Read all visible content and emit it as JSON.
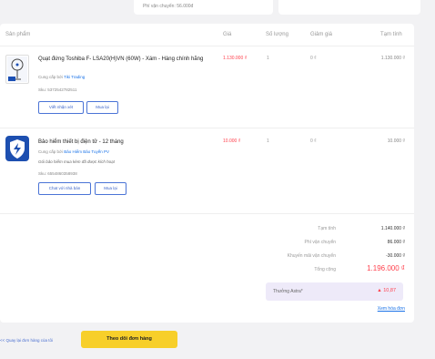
{
  "shipping_note": "Phí vận chuyển: 56.000đ",
  "columns": {
    "product": "Sản phẩm",
    "price": "Giá",
    "qty": "Số lượng",
    "discount": "Giảm giá",
    "subtotal": "Tạm tính"
  },
  "items": [
    {
      "name": "Quạt đứng Toshiba F- LSA20(H)VN (60W) - Xám - Hàng chính hãng",
      "supplier_prefix": "Cung cấp bởi",
      "supplier": "Tiki Trading",
      "sku": "Sku: 5372542782511",
      "btn1": "Viết nhận xét",
      "btn2": "Mua lại",
      "price": "1.130.000 ₫",
      "qty": "1",
      "discount": "0 ₫",
      "subtotal": "1.130.000 ₫"
    },
    {
      "name": "Bảo hiểm thiết bị điện tử - 12 tháng",
      "supplier_prefix": "Cung cấp bởi",
      "supplier": "Bảo Hiểm Bảo Tuyến PV",
      "note": "Gói bảo hiểm mua kèm đã được kích hoạt",
      "sku": "Sku: 6554860358938",
      "btn1": "Chat với nhà bán",
      "btn2": "Mua lại",
      "price": "10.000 ₫",
      "qty": "1",
      "discount": "0 ₫",
      "subtotal": "10.000 ₫"
    }
  ],
  "summary": {
    "subtotal_label": "Tạm tính",
    "subtotal": "1.140.000 ₫",
    "shipping_label": "Phí vận chuyển",
    "shipping": "86.000 ₫",
    "ship_discount_label": "Khuyến mãi vận chuyển",
    "ship_discount": "-30.000 ₫",
    "total_label": "Tổng cộng",
    "total": "1.196.000 ₫",
    "astra_label": "Thưởng Astra*",
    "astra_value": "10,87",
    "invoice_link": "Xem hóa đơn"
  },
  "back_link": "<< Quay lại đơn hàng của tôi",
  "track_button": "Theo dõi đơn hàng",
  "colors": {
    "accent_blue": "#4b74d6",
    "total_red": "#ff424e",
    "yellow_button": "#f7cf2a",
    "astra_bg": "#eeeaf9"
  }
}
